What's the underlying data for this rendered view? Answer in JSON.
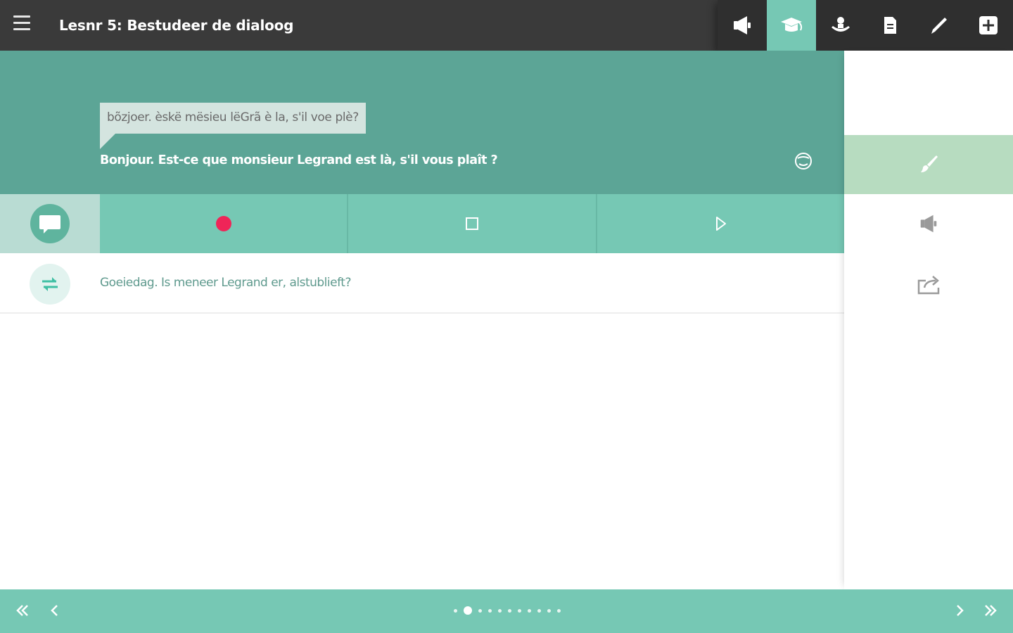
{
  "header": {
    "title": "Lesnr 5: Bestudeer de dialoog",
    "tools": [
      {
        "name": "megaphone-icon",
        "active": false
      },
      {
        "name": "graduation-cap-icon",
        "active": true
      },
      {
        "name": "speaking-head-icon",
        "active": false
      },
      {
        "name": "document-icon",
        "active": false
      },
      {
        "name": "pencil-icon",
        "active": false
      },
      {
        "name": "plus-icon",
        "active": false
      }
    ]
  },
  "dialog": {
    "phonetic": "bõzjoer. èskë mësieu lëGrã è la, s'il voe plè?",
    "sentence": "Bonjour. Est-ce que monsieur Legrand est là, s'il vous plaît ?"
  },
  "translation": {
    "text": "Goeiedag. Is meneer Legrand er, alstublieft?"
  },
  "pagination": {
    "total": 11,
    "current": 2
  },
  "colors": {
    "topbar": "#3a3a3a",
    "header": "#5ca596",
    "accent": "#76c8b4",
    "record": "#ef2558",
    "panel_active": "#b7dcc0"
  }
}
